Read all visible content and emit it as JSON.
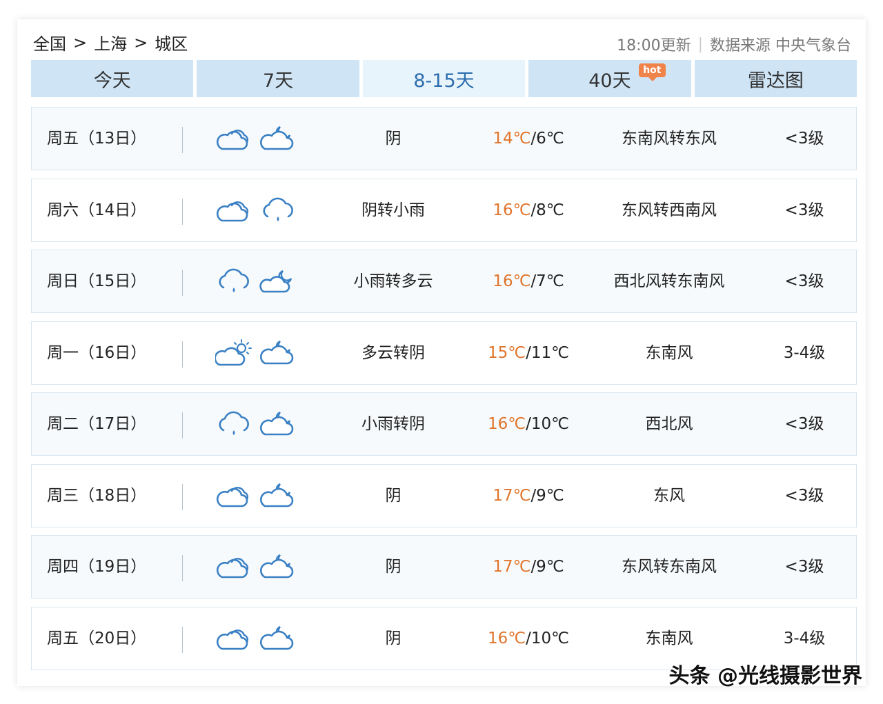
{
  "breadcrumb": {
    "country": "全国",
    "separator": ">",
    "city": "上海",
    "district": "城区"
  },
  "meta": {
    "updated": "18:00更新",
    "source": "数据来源 中央气象台"
  },
  "tabs": [
    {
      "label": "今天"
    },
    {
      "label": "7天"
    },
    {
      "label": "8-15天",
      "active": true
    },
    {
      "label": "40天",
      "badge": "hot"
    },
    {
      "label": "雷达图"
    }
  ],
  "colors": {
    "accent": "#2b6cad",
    "tab_bg": "#cfe5f6",
    "tab_active_bg": "#e8f4fc",
    "high_temp": "#e0752c",
    "badge": "#f0834a",
    "icon": "#3a80c4"
  },
  "forecast": [
    {
      "day": "周五（13日）",
      "icon_day": "overcast-icon",
      "icon_night": "cloudy-night-icon",
      "condition": "阴",
      "high": "14℃",
      "low": "/6℃",
      "wind": "东南风转东风",
      "level": "<3级"
    },
    {
      "day": "周六（14日）",
      "icon_day": "overcast-icon",
      "icon_night": "light-rain-icon",
      "condition": "阴转小雨",
      "high": "16℃",
      "low": "/8℃",
      "wind": "东风转西南风",
      "level": "<3级"
    },
    {
      "day": "周日（15日）",
      "icon_day": "light-rain-icon",
      "icon_night": "partly-cloudy-night-icon",
      "condition": "小雨转多云",
      "high": "16℃",
      "low": "/7℃",
      "wind": "西北风转东南风",
      "level": "<3级"
    },
    {
      "day": "周一（16日）",
      "icon_day": "partly-cloudy-day-icon",
      "icon_night": "cloudy-night-icon",
      "condition": "多云转阴",
      "high": "15℃",
      "low": "/11℃",
      "wind": "东南风",
      "level": "3-4级"
    },
    {
      "day": "周二（17日）",
      "icon_day": "light-rain-icon",
      "icon_night": "cloudy-night-icon",
      "condition": "小雨转阴",
      "high": "16℃",
      "low": "/10℃",
      "wind": "西北风",
      "level": "<3级"
    },
    {
      "day": "周三（18日）",
      "icon_day": "overcast-icon",
      "icon_night": "cloudy-night-icon",
      "condition": "阴",
      "high": "17℃",
      "low": "/9℃",
      "wind": "东风",
      "level": "<3级"
    },
    {
      "day": "周四（19日）",
      "icon_day": "overcast-icon",
      "icon_night": "cloudy-night-icon",
      "condition": "阴",
      "high": "17℃",
      "low": "/9℃",
      "wind": "东风转东南风",
      "level": "<3级"
    },
    {
      "day": "周五（20日）",
      "icon_day": "overcast-icon",
      "icon_night": "cloudy-night-icon",
      "condition": "阴",
      "high": "16℃",
      "low": "/10℃",
      "wind": "东南风",
      "level": "3-4级"
    }
  ],
  "watermark": "头条 @光线摄影世界"
}
